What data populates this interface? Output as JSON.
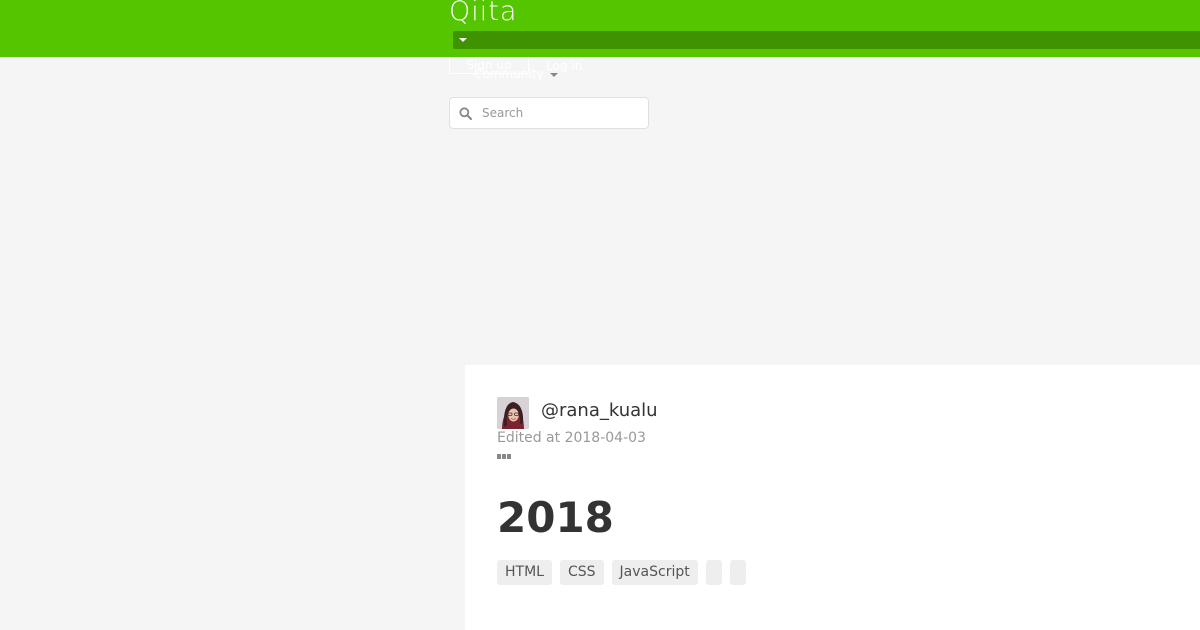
{
  "header": {
    "logo_text": "Qiita",
    "brand_color": "#55c500",
    "signup_label": "Sign up",
    "login_label": "Log in",
    "community_label": "Community"
  },
  "search": {
    "placeholder": "Search"
  },
  "article": {
    "author": "@rana_kualu",
    "edited_at": "Edited at 2018-04-03",
    "title": "2018",
    "tags": [
      "HTML",
      "CSS",
      "JavaScript",
      "",
      ""
    ]
  },
  "icons": {
    "search": "search-icon",
    "dropdown": "chevron-down-icon",
    "more": "more-options-icon"
  }
}
